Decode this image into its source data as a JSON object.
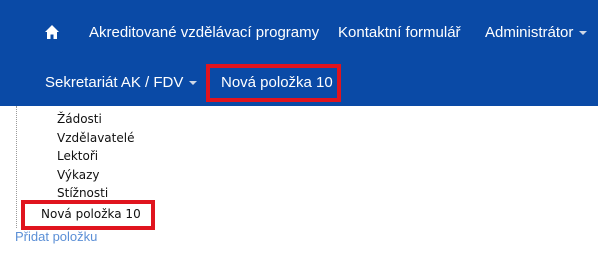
{
  "navbar": {
    "home_icon": "home-icon",
    "items": [
      {
        "label": "Akreditované vzdělávací programy"
      },
      {
        "label": "Kontaktní formulář"
      },
      {
        "label": "Administrátor"
      },
      {
        "label": "Sekretariát AK / FDV"
      },
      {
        "label": "Nová položka 10"
      }
    ],
    "background": "#0a4aa6"
  },
  "menu": {
    "items": [
      {
        "label": "Žádosti"
      },
      {
        "label": "Vzdělavatelé"
      },
      {
        "label": "Lektoři"
      },
      {
        "label": "Výkazy"
      },
      {
        "label": "Stížnosti"
      }
    ],
    "new_item": "Nová položka 10"
  },
  "add_link": "Přidat položku",
  "highlight_color": "#e0141e"
}
